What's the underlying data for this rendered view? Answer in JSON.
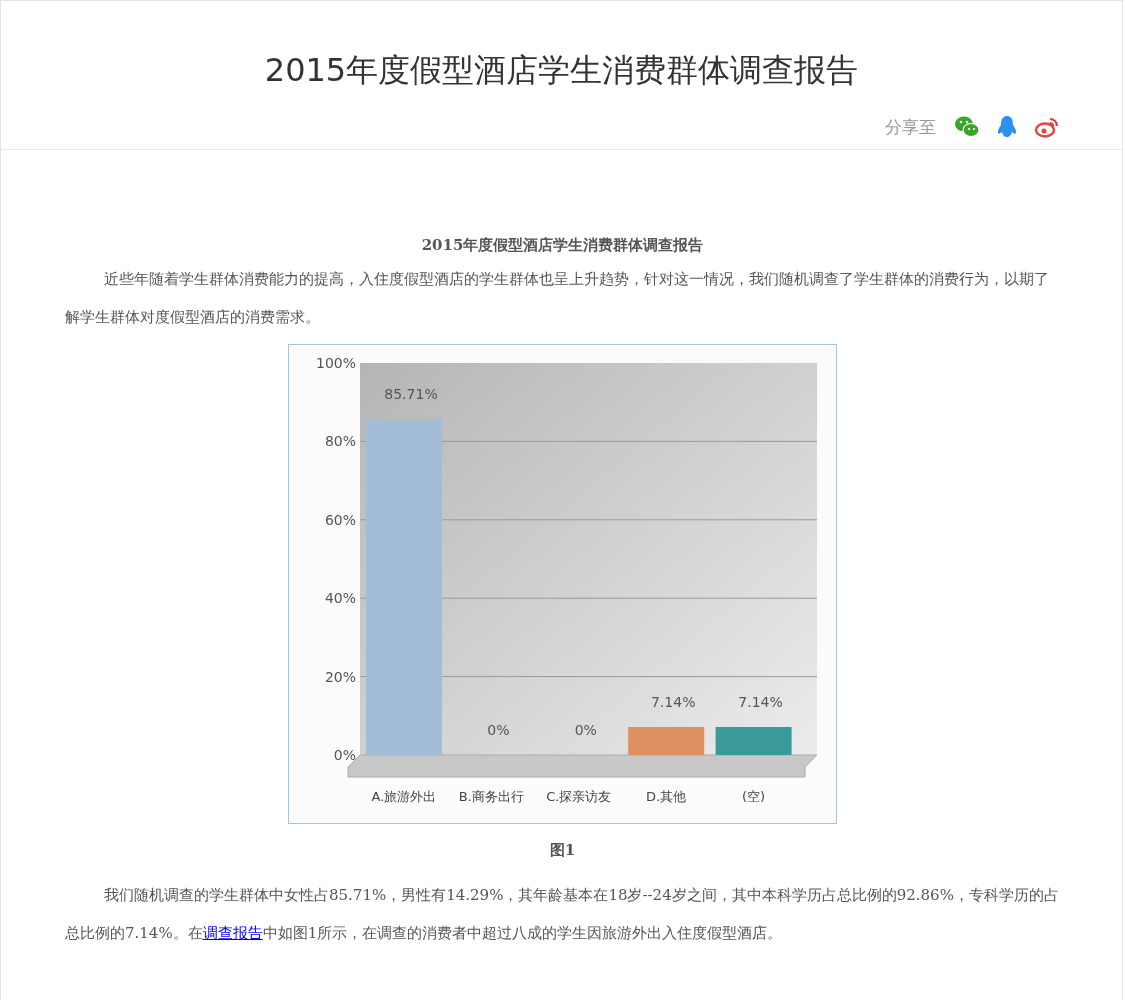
{
  "header": {
    "title": "2015年度假型酒店学生消费群体调查报告",
    "share_label": "分享至"
  },
  "article": {
    "heading": "2015年度假型酒店学生消费群体调查报告",
    "intro": "近些年随着学生群体消费能力的提高，入住度假型酒店的学生群体也呈上升趋势，针对这一情况，我们随机调查了学生群体的消费行为，以期了解学生群体对度假型酒店的消费需求。",
    "figure": {
      "caption": "图1",
      "chart_data": {
        "type": "bar",
        "categories": [
          "A.旅游外出",
          "B.商务出行",
          "C.探亲访友",
          "D.其他",
          "(空)"
        ],
        "series": [
          {
            "color": "#a4bdd6",
            "values": [
              85.71,
              null,
              null,
              null,
              null
            ]
          },
          {
            "color": "#e8c04a",
            "values": [
              null,
              0,
              null,
              null,
              null
            ]
          },
          {
            "color": "#a2c455",
            "values": [
              null,
              null,
              0,
              null,
              null
            ]
          },
          {
            "color": "#de9060",
            "values": [
              null,
              null,
              null,
              7.14,
              null
            ]
          },
          {
            "color": "#3a9a9a",
            "values": [
              null,
              null,
              null,
              null,
              7.14
            ]
          }
        ],
        "grid": true,
        "ylim": [
          0,
          100
        ],
        "yticks": [
          {
            "value": 0,
            "label": "0%"
          },
          {
            "value": 20,
            "label": "20%"
          },
          {
            "value": 40,
            "label": "40%"
          },
          {
            "value": 60,
            "label": "60%"
          },
          {
            "value": 80,
            "label": "80%"
          },
          {
            "value": 100,
            "label": "100%"
          }
        ],
        "value_labels": [
          "85.71%",
          "0%",
          "0%",
          "7.14%",
          "7.14%"
        ]
      }
    },
    "body": {
      "before": "我们随机调查的学生群体中女性占85.71%，男性有14.29%，其年龄基本在18岁--24岁之间，其中本科学历占总比例的92.86%，专科学历的占总比例的7.14%。在",
      "link": "调查报告",
      "after": "中如图1所示，在调查的消费者中超过八成的学生因旅游外出入住度假型酒店。"
    }
  }
}
